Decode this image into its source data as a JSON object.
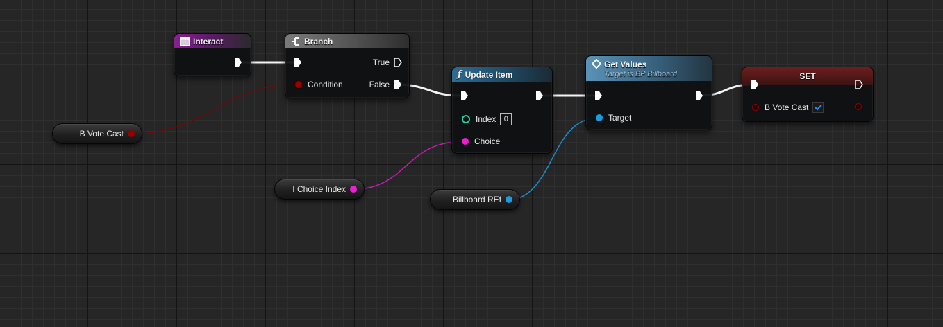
{
  "nodes": {
    "interact": {
      "title": "Interact"
    },
    "branch": {
      "title": "Branch",
      "true_label": "True",
      "condition_label": "Condition",
      "false_label": "False"
    },
    "update_item": {
      "title": "Update Item",
      "index_label": "Index",
      "index_value": "0",
      "choice_label": "Choice"
    },
    "get_values": {
      "title": "Get Values",
      "subtitle": "Target is BP Billboard",
      "target_label": "Target"
    },
    "set": {
      "title": "SET",
      "var_label": "B Vote Cast",
      "checked": true
    }
  },
  "variables": {
    "b_vote_cast": "B Vote Cast",
    "i_choice_index": "I Choice Index",
    "billboard_ref": "Billboard REf"
  },
  "colors": {
    "boolean_pin": "#950000",
    "integer_pin": "#1ed3a0",
    "choice_pin": "#e81fd3",
    "object_pin": "#1c9be2",
    "exec_pin": "#ffffff"
  },
  "icons": {
    "interact": "event-icon",
    "branch": "branch-icon",
    "update_item": "function-icon",
    "get_values": "function-diamond-icon"
  }
}
